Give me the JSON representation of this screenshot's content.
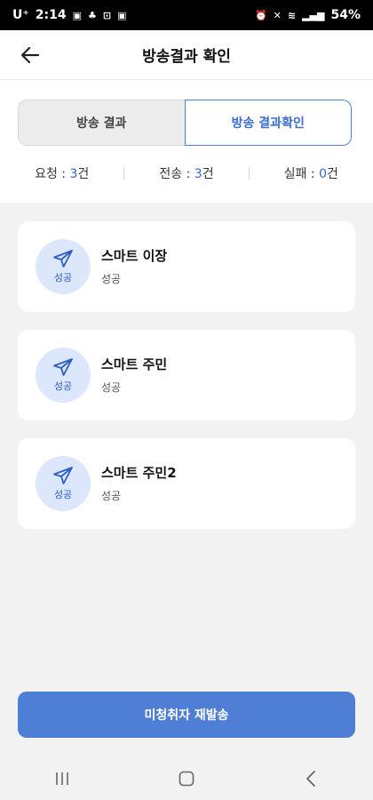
{
  "status_bar": {
    "carrier": "U⁺",
    "time": "2:14",
    "battery": "54%"
  },
  "header": {
    "title": "방송결과 확인",
    "back_icon": "arrow-left-icon"
  },
  "tabs": [
    {
      "label": "방송 결과",
      "active": false
    },
    {
      "label": "방송 결과확인",
      "active": true
    }
  ],
  "stats": {
    "request": {
      "label": "요청 : ",
      "value": "3",
      "unit": "건"
    },
    "sent": {
      "label": "전송 : ",
      "value": "3",
      "unit": "건"
    },
    "failed": {
      "label": "실패 : ",
      "value": "0",
      "unit": "건"
    }
  },
  "results": [
    {
      "name": "스마트 이장",
      "status": "성공",
      "badge": "성공",
      "icon": "paper-plane-icon"
    },
    {
      "name": "스마트 주민",
      "status": "성공",
      "badge": "성공",
      "icon": "paper-plane-icon"
    },
    {
      "name": "스마트 주민2",
      "status": "성공",
      "badge": "성공",
      "icon": "paper-plane-icon"
    }
  ],
  "resend_button": {
    "label": "미청취자 재발송"
  },
  "colors": {
    "accent": "#4f7fd4",
    "badge_bg": "#dce7fb",
    "number": "#2e6bd6"
  }
}
